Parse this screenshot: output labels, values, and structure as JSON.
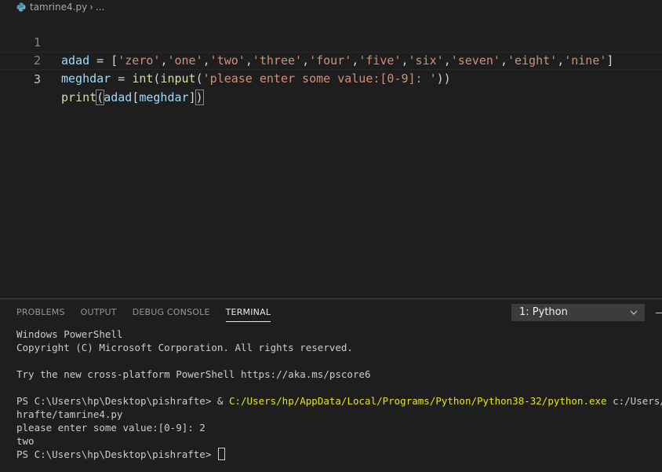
{
  "breadcrumb": {
    "file": "tamrine4.py",
    "separator": "›",
    "ellipsis": "..."
  },
  "editor": {
    "lines": [
      {
        "number": "1",
        "tokens": [
          {
            "t": "adad",
            "c": "var"
          },
          {
            "t": " = [",
            "c": "op"
          },
          {
            "t": "'zero'",
            "c": "str"
          },
          {
            "t": ",",
            "c": "op"
          },
          {
            "t": "'one'",
            "c": "str"
          },
          {
            "t": ",",
            "c": "op"
          },
          {
            "t": "'two'",
            "c": "str"
          },
          {
            "t": ",",
            "c": "op"
          },
          {
            "t": "'three'",
            "c": "str"
          },
          {
            "t": ",",
            "c": "op"
          },
          {
            "t": "'four'",
            "c": "str"
          },
          {
            "t": ",",
            "c": "op"
          },
          {
            "t": "'five'",
            "c": "str"
          },
          {
            "t": ",",
            "c": "op"
          },
          {
            "t": "'six'",
            "c": "str"
          },
          {
            "t": ",",
            "c": "op"
          },
          {
            "t": "'seven'",
            "c": "str"
          },
          {
            "t": ",",
            "c": "op"
          },
          {
            "t": "'eight'",
            "c": "str"
          },
          {
            "t": ",",
            "c": "op"
          },
          {
            "t": "'nine'",
            "c": "str"
          },
          {
            "t": "]",
            "c": "op"
          }
        ]
      },
      {
        "number": "2",
        "tokens": [
          {
            "t": "meghdar",
            "c": "var"
          },
          {
            "t": " = ",
            "c": "op"
          },
          {
            "t": "int",
            "c": "fn"
          },
          {
            "t": "(",
            "c": "op"
          },
          {
            "t": "input",
            "c": "fn"
          },
          {
            "t": "(",
            "c": "op"
          },
          {
            "t": "'please enter some value:[0-9]: '",
            "c": "str"
          },
          {
            "t": "))",
            "c": "op"
          }
        ]
      },
      {
        "number": "3",
        "current": true,
        "tokens": [
          {
            "t": "print",
            "c": "fn"
          },
          {
            "t": "(",
            "c": "op bm"
          },
          {
            "t": "adad",
            "c": "var"
          },
          {
            "t": "[",
            "c": "op"
          },
          {
            "t": "meghdar",
            "c": "var"
          },
          {
            "t": "]",
            "c": "op"
          },
          {
            "t": ")",
            "c": "op bm"
          }
        ]
      }
    ]
  },
  "panel": {
    "tabs": [
      {
        "label": "PROBLEMS"
      },
      {
        "label": "OUTPUT"
      },
      {
        "label": "DEBUG CONSOLE"
      },
      {
        "label": "TERMINAL",
        "active": true
      }
    ],
    "terminal_select": {
      "value": "1: Python"
    }
  },
  "terminal": {
    "lines": [
      [
        {
          "t": "Windows PowerShell"
        }
      ],
      [
        {
          "t": "Copyright (C) Microsoft Corporation. All rights reserved."
        }
      ],
      [
        {
          "t": ""
        }
      ],
      [
        {
          "t": "Try the new cross-platform PowerShell https://aka.ms/pscore6"
        }
      ],
      [
        {
          "t": ""
        }
      ],
      [
        {
          "t": "PS C:\\Users\\hp\\Desktop\\pishrafte> & "
        },
        {
          "t": "C:/Users/hp/AppData/Local/Programs/Python/Python38-32/python.exe",
          "c": "yellow"
        },
        {
          "t": " c:/Users/hp/Deskt"
        }
      ],
      [
        {
          "t": "hrafte/tamrine4.py"
        }
      ],
      [
        {
          "t": "please enter some value:[0-9]: 2"
        }
      ],
      [
        {
          "t": "two"
        }
      ],
      [
        {
          "t": "PS C:\\Users\\hp\\Desktop\\pishrafte> "
        }
      ]
    ],
    "cursor": true
  },
  "icons": {
    "file": "python-icon",
    "dropdown": "chevron-down-icon",
    "new_terminal": "plus-icon"
  },
  "colors": {
    "background": "#1e1e1e",
    "string": "#ce9178",
    "variable": "#9cdcfe",
    "function": "#dcdcaa",
    "path_highlight": "#e5e510"
  }
}
